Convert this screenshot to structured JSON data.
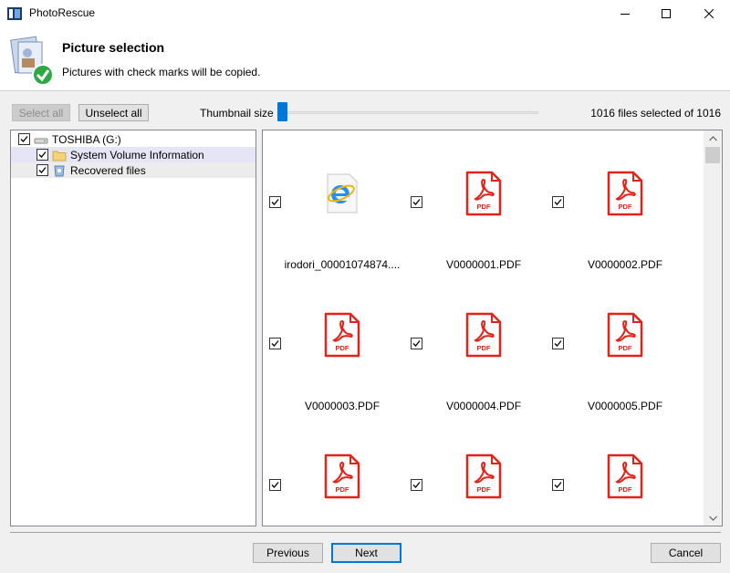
{
  "window": {
    "title": "PhotoRescue"
  },
  "header": {
    "title": "Picture selection",
    "subtitle": "Pictures with check marks will be copied."
  },
  "toolbar": {
    "select_all": "Select all",
    "unselect_all": "Unselect all",
    "thumbnail_size_label": "Thumbnail size",
    "files_selected": "1016 files selected of 1016",
    "thumbnail_size_level": 0
  },
  "tree": {
    "items": [
      {
        "label": "TOSHIBA (G:)",
        "icon": "drive-icon",
        "checked": true
      },
      {
        "label": "System Volume Information",
        "icon": "folder-icon",
        "checked": true
      },
      {
        "label": "Recovered files",
        "icon": "recycle-folder-icon",
        "checked": true
      }
    ]
  },
  "grid": {
    "files": [
      {
        "name": "irodori_00001074874....",
        "icon": "ie-html-icon",
        "checked": true
      },
      {
        "name": "V0000001.PDF",
        "icon": "pdf-icon",
        "checked": true
      },
      {
        "name": "V0000002.PDF",
        "icon": "pdf-icon",
        "checked": true
      },
      {
        "name": "V0000003.PDF",
        "icon": "pdf-icon",
        "checked": true
      },
      {
        "name": "V0000004.PDF",
        "icon": "pdf-icon",
        "checked": true
      },
      {
        "name": "V0000005.PDF",
        "icon": "pdf-icon",
        "checked": true
      },
      {
        "name": "",
        "icon": "pdf-icon",
        "checked": true
      },
      {
        "name": "",
        "icon": "pdf-icon",
        "checked": true
      },
      {
        "name": "",
        "icon": "pdf-icon",
        "checked": true
      }
    ],
    "pdf_badge": "PDF"
  },
  "footer": {
    "previous": "Previous",
    "next": "Next",
    "cancel": "Cancel"
  },
  "colors": {
    "accent": "#0078d7",
    "pdf_red": "#e2231a"
  }
}
